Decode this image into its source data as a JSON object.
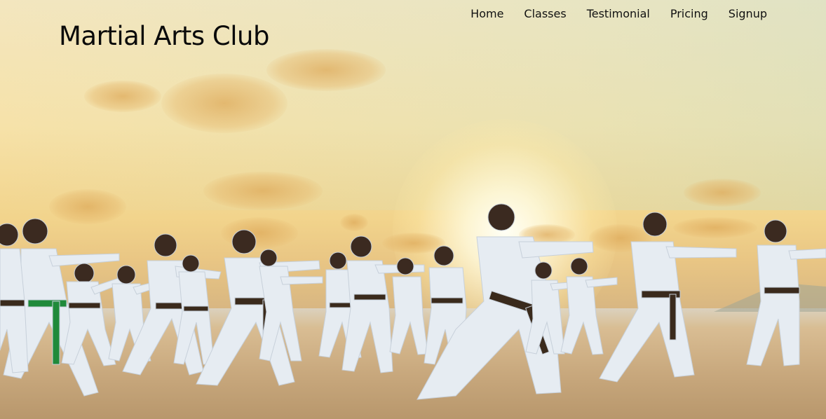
{
  "site": {
    "title": "Martial Arts Club"
  },
  "nav": {
    "items": [
      "Home",
      "Classes",
      "Testimonial",
      "Pricing",
      "Signup"
    ]
  },
  "hero": {
    "image_subject": "karate-class-on-beach-at-sunset"
  },
  "colors": {
    "sky": "#f6e2a9",
    "sand": "#c8a87d",
    "gi": "#e6ecf2",
    "belt_black": "#3a2a1c",
    "belt_green": "#1f8a3a",
    "text": "#0a0a0a"
  }
}
